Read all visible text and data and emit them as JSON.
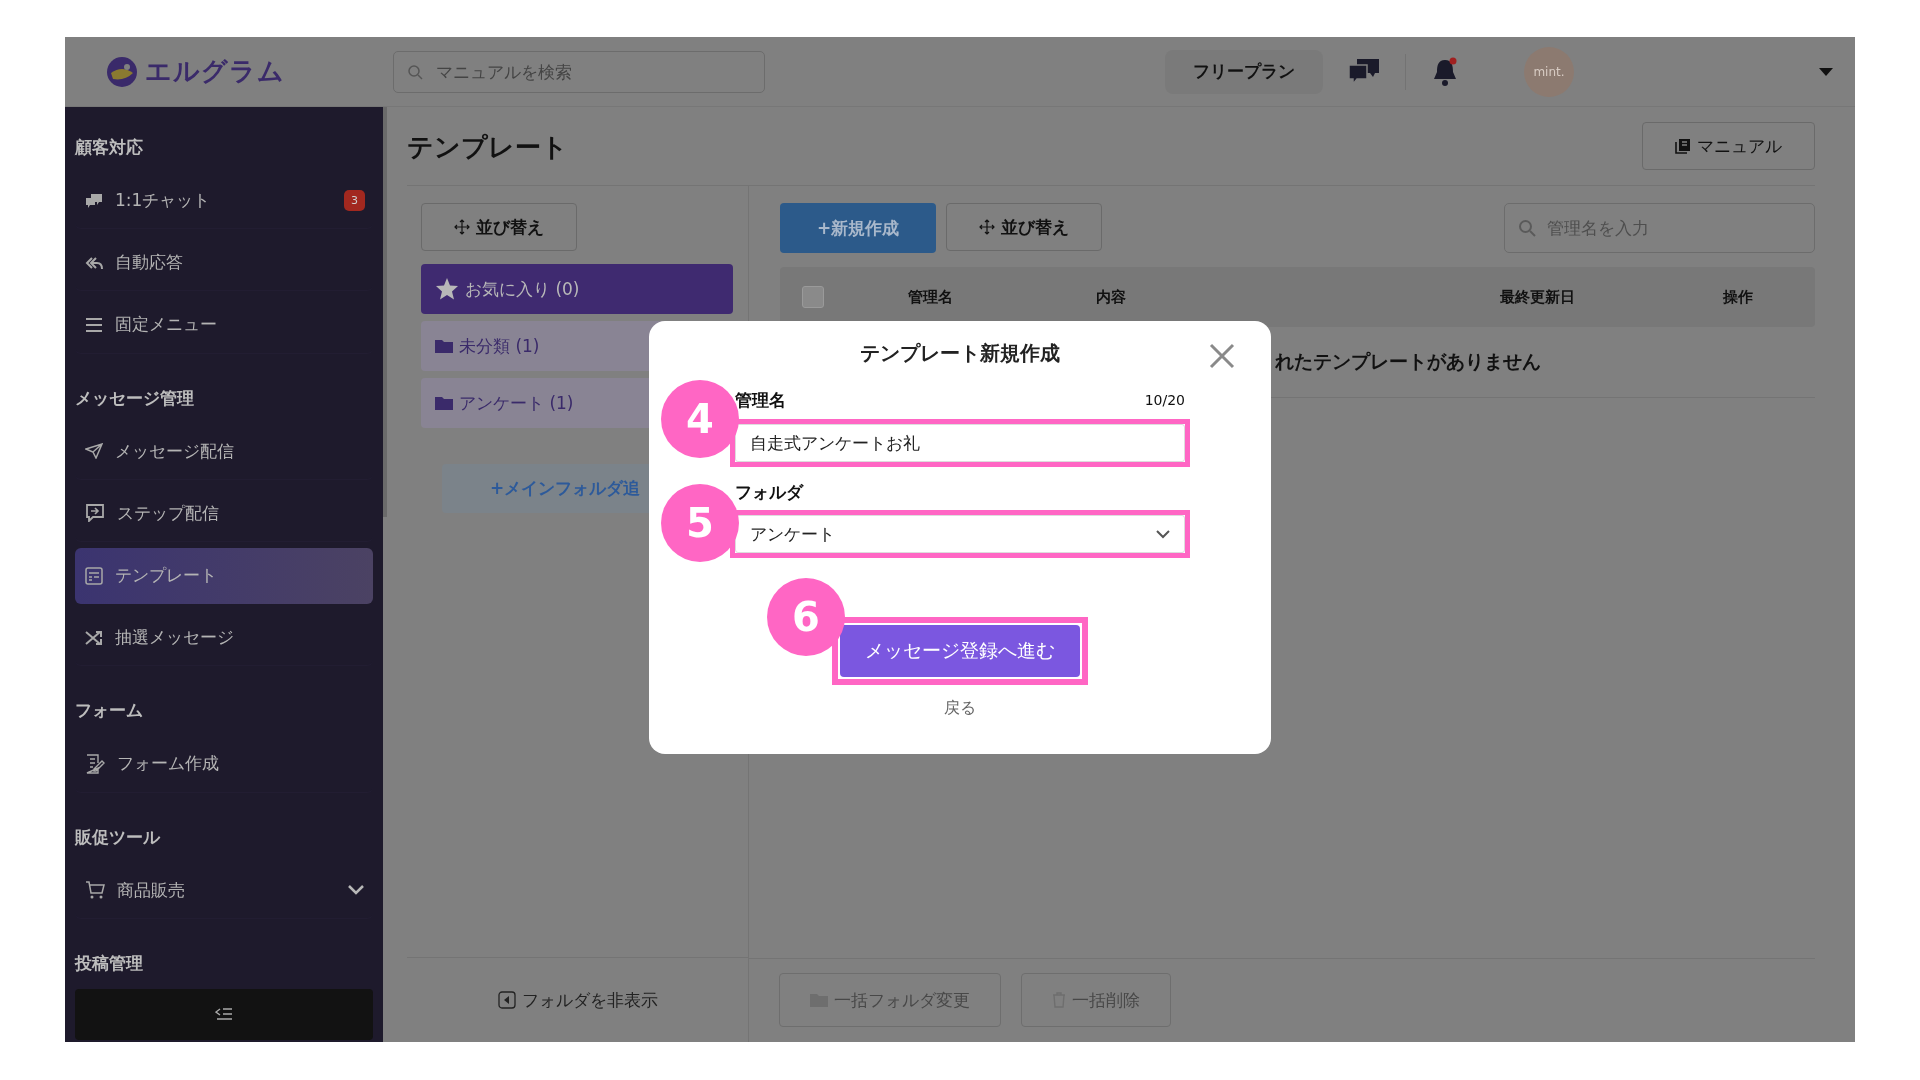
{
  "header": {
    "logo": "エルグラム",
    "search": {
      "placeholder": "マニュアルを検索"
    },
    "plan": "フリープラン",
    "avatar": "mint."
  },
  "sidebar": {
    "sections": [
      {
        "title": "顧客対応",
        "items": [
          {
            "label": "1:1チャット",
            "badge": "3",
            "selected": false
          },
          {
            "label": "自動応答",
            "selected": false
          },
          {
            "label": "固定メニュー",
            "selected": false
          }
        ]
      },
      {
        "title": "メッセージ管理",
        "items": [
          {
            "label": "メッセージ配信",
            "selected": false
          },
          {
            "label": "ステップ配信",
            "selected": false
          },
          {
            "label": "テンプレート",
            "selected": true
          },
          {
            "label": "抽選メッセージ",
            "selected": false
          }
        ]
      },
      {
        "title": "フォーム",
        "items": [
          {
            "label": "フォーム作成",
            "selected": false
          }
        ]
      },
      {
        "title": "販促ツール",
        "items": [
          {
            "label": "商品販売",
            "selected": false,
            "expanded": false
          }
        ]
      },
      {
        "title": "投稿管理"
      }
    ]
  },
  "page": {
    "title": "テンプレート",
    "manual_button": "マニュアル"
  },
  "folders": {
    "sort_button": "並び替え",
    "items": [
      {
        "kind": "favorite",
        "label": "お気に入り (0)",
        "selected": true
      },
      {
        "kind": "folder",
        "label": "未分類 (1)",
        "selected": false
      },
      {
        "kind": "folder",
        "label": "アンケート (1)",
        "selected": false
      }
    ],
    "add_button": "+メインフォルダ追",
    "hide_button": "フォルダを非表示"
  },
  "templates": {
    "new_button": "+新規作成",
    "sort_button": "並び替え",
    "search": {
      "placeholder": "管理名を入力"
    },
    "select_all": {
      "checked": false
    },
    "columns": [
      "管理名",
      "内容",
      "最終更新日",
      "操作"
    ],
    "empty_message": "れたテンプレートがありません",
    "bulk_buttons": [
      {
        "label": "一括フォルダ変更",
        "disabled": true
      },
      {
        "label": "一括削除",
        "disabled": true
      }
    ]
  },
  "modal": {
    "title": "テンプレート新規作成",
    "name_label": "管理名",
    "counter": "10/20",
    "name_value": "自走式アンケートお礼",
    "folder_label": "フォルダ",
    "folder_value": "アンケート",
    "submit_button": "メッセージ登録へ進む",
    "back_link": "戻る"
  },
  "annotations": [
    {
      "label": "4"
    },
    {
      "label": "5"
    },
    {
      "label": "6"
    }
  ]
}
